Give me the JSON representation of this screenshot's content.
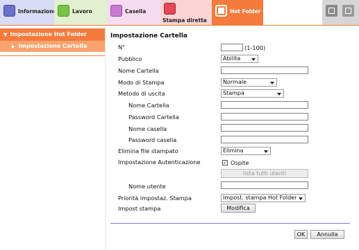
{
  "tabs": [
    {
      "label": "Informazione",
      "icon": "info-icon"
    },
    {
      "label": "Lavoro",
      "icon": "job-icon"
    },
    {
      "label": "Casella",
      "icon": "box-icon"
    },
    {
      "label": "Stampa diretta",
      "icon": "direct-print-icon"
    },
    {
      "label": "Hot Folder",
      "icon": "hot-folder-icon"
    }
  ],
  "sidebar": {
    "items": [
      {
        "label": "Impostazione Hot Folder"
      },
      {
        "label": "Impostazione Cartella"
      }
    ]
  },
  "form": {
    "title": "Impostazione Cartella",
    "number_label": "N°",
    "number_value": "",
    "number_range": "(1-100)",
    "public_label": "Pubblico",
    "public_value": "Abilita",
    "folder_name_label": "Nome Cartella",
    "folder_name_value": "",
    "print_mode_label": "Modo di Stampa",
    "print_mode_value": "Normale",
    "output_method_label": "Metodo di uscita",
    "output_method_value": "Stampa",
    "sub_folder_name_label": "Nome Cartella",
    "folder_password_label": "Password Cartella",
    "box_name_label": "Nome casella",
    "box_password_label": "Password casella",
    "delete_printed_label": "Elimina file stampato",
    "delete_printed_value": "Elimina",
    "auth_label": "Impostazione Autenticazione",
    "guest_label": "Ospite",
    "guest_checked": true,
    "list_users_label": "lista tutti utenti",
    "user_name_label": "Nome utente",
    "priority_label": "Priorità impostaz. Stampa",
    "priority_value": "Impost. stampa Hot Folder",
    "print_settings_label": "Impost stampa",
    "modify_label": "Modifica"
  },
  "footer": {
    "ok_label": "OK",
    "cancel_label": "Annulla"
  }
}
